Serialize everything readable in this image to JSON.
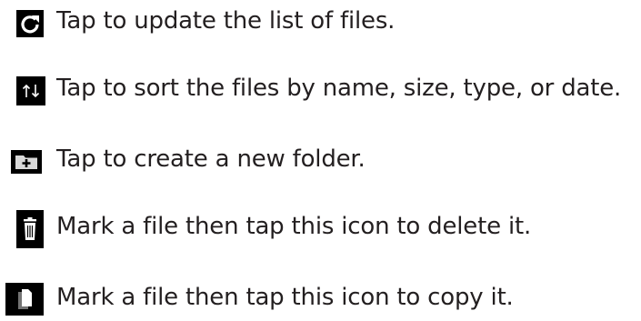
{
  "items": [
    {
      "icon": "refresh-icon",
      "text": "Tap to update the list of files."
    },
    {
      "icon": "sort-icon",
      "text": "Tap to sort the files by name, size, type, or date."
    },
    {
      "icon": "new-folder-icon",
      "text": "Tap to create a new folder."
    },
    {
      "icon": "trash-icon",
      "text": "Mark a file then tap this icon to delete it."
    },
    {
      "icon": "copy-icon",
      "text": "Mark a file then tap this icon to copy it."
    }
  ],
  "colors": {
    "text": "#231f20",
    "icon_background": "#000000",
    "icon_glyph": "#ffffff"
  }
}
